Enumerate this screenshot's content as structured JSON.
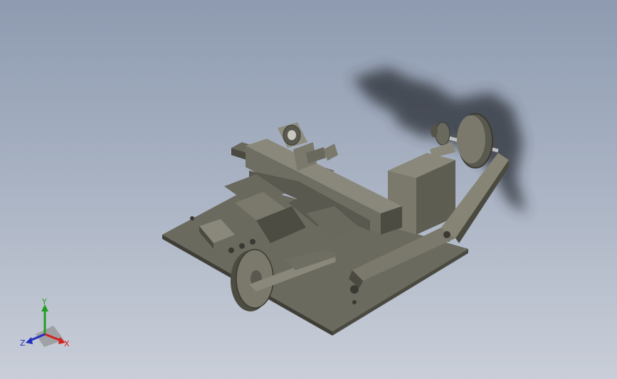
{
  "viewport": {
    "background_top": "#8e9bb0",
    "background_bottom": "#c9ced8"
  },
  "model": {
    "base_plate_color": "#6b6a5f",
    "part_color": "#7a796c",
    "part_dark_color": "#4a4a40",
    "part_light_color": "#9a9888"
  },
  "triad": {
    "x_label": "X",
    "y_label": "Y",
    "z_label": "Z",
    "x_color": "#d42020",
    "y_color": "#20a020",
    "z_color": "#2030c0"
  }
}
